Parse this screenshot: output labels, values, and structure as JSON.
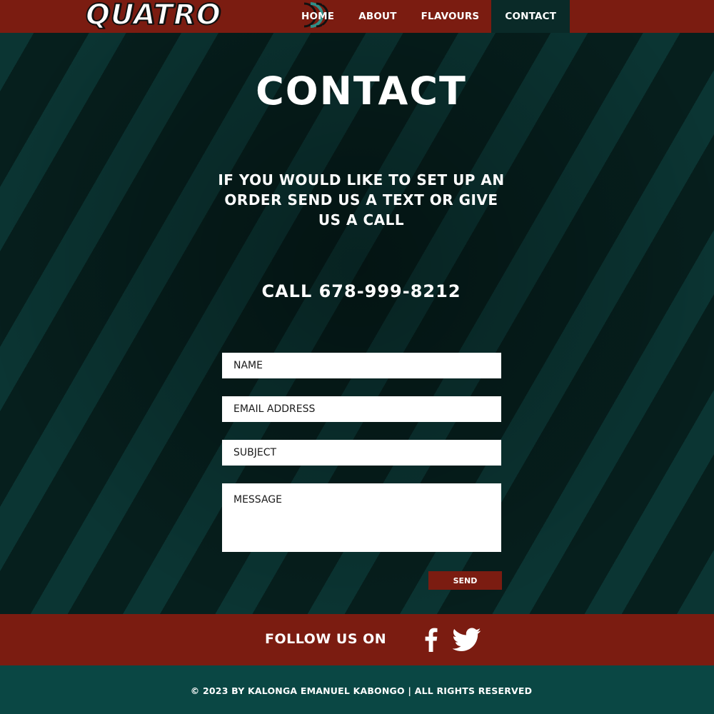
{
  "header": {
    "logo_text": "QUATRO",
    "nav": [
      {
        "label": "HOME"
      },
      {
        "label": "ABOUT"
      },
      {
        "label": "FLAVOURS"
      },
      {
        "label": "CONTACT",
        "active": true
      }
    ]
  },
  "main": {
    "title": "CONTACT",
    "intro": "IF YOU WOULD LIKE TO SET UP AN ORDER SEND US A TEXT OR GIVE US A CALL",
    "phone": "CALL 678-999-8212",
    "form": {
      "name_placeholder": "NAME",
      "email_placeholder": "EMAIL ADDRESS",
      "subject_placeholder": "SUBJECT",
      "message_placeholder": "MESSAGE",
      "send_label": "SEND"
    }
  },
  "follow": {
    "label": "FOLLOW US ON",
    "icons": [
      "facebook-icon",
      "twitter-icon"
    ]
  },
  "footer": {
    "copyright": "© 2023 BY KALONGA EMANUEL KABONGO | ALL RIGHTS RESERVED"
  },
  "colors": {
    "brand_red": "#7b1c11",
    "dark_teal": "#06211f",
    "stripe_teal": "#0b3533",
    "footer_teal": "#0a4744",
    "active_nav": "#0a2a28"
  }
}
